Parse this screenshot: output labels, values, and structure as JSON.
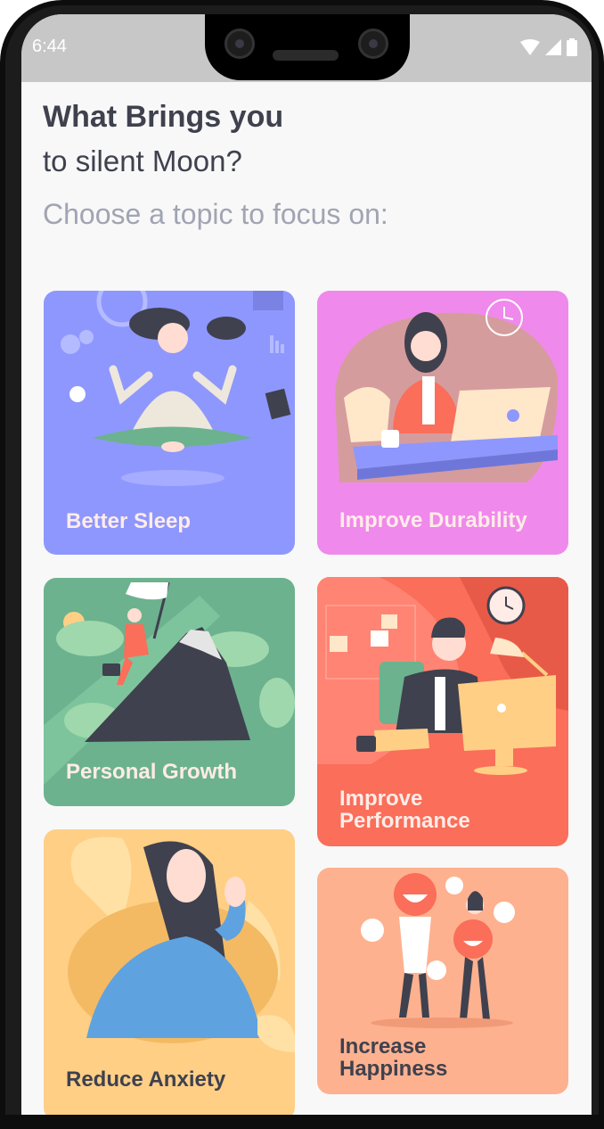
{
  "status_bar": {
    "time": "6:44"
  },
  "header": {
    "title": "What Brings you",
    "subtitle": "to silent Moon?",
    "prompt": "Choose a topic to focus on:"
  },
  "topics": [
    {
      "label": "Better Sleep",
      "color": "#8e97fd",
      "text_color": "#ffece7"
    },
    {
      "label": "Improve Durability",
      "color": "#f089ec",
      "text_color": "#ffece7"
    },
    {
      "label": "Personal Growth",
      "color": "#6cb28e",
      "text_color": "#ffece7"
    },
    {
      "label": "Improve\nPerformance",
      "color": "#fa6e5a",
      "text_color": "#ffece7"
    },
    {
      "label": "Reduce Anxiety",
      "color": "#feb18f",
      "text_color": "#3f414e"
    },
    {
      "label": "Increase\nHappiness",
      "color": "#ffcf86",
      "text_color": "#3f414e"
    }
  ]
}
